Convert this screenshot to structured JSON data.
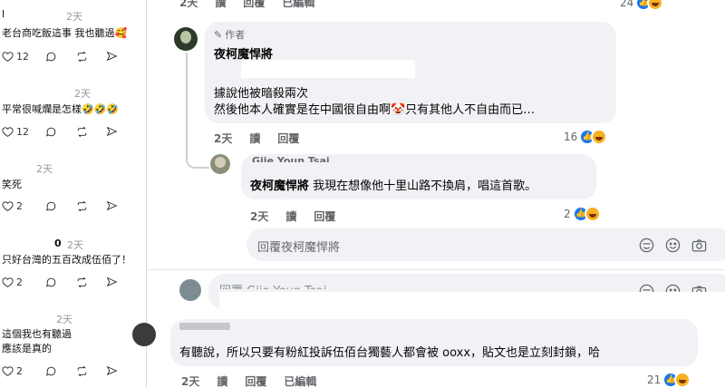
{
  "left_pane": {
    "posts": [
      {
        "time": "2天",
        "text_lines": [
          "老台商吃飯這事 我也聽過🥰"
        ],
        "likes": "12"
      },
      {
        "time": "2天",
        "text_lines": [
          "平常很喊爛是怎樣🤣🤣🤣"
        ],
        "likes": "12"
      },
      {
        "time": "2天",
        "text_lines": [
          "笑死"
        ],
        "likes": "2"
      },
      {
        "time": "2天",
        "count": "0",
        "text_lines": [
          "只好台灣的五百改成伍佰了！"
        ],
        "likes": "2"
      },
      {
        "time": "2天",
        "text_lines": [
          "這個我也有聽過",
          "應該是真的"
        ],
        "likes": "2"
      }
    ],
    "head_fragment": "l"
  },
  "comments": {
    "top_meta": {
      "time": "2天",
      "read": "讀",
      "reply": "回覆",
      "edited": "已編輯",
      "count": "24"
    },
    "author_comment": {
      "badge": "作者",
      "name": "夜柯魔悍將",
      "line1": "據說他被暗殺兩次",
      "line2": "然後他本人確實是在中國很自由啊🤡只有其他人不自由而已…",
      "meta": {
        "time": "2天",
        "read": "讀",
        "reply": "回覆",
        "count": "16"
      }
    },
    "reply_comment": {
      "partial_name": "Gjie Youn Tsai",
      "mention": "夜柯魔悍將",
      "text": "我現在想像他十里山路不換肩，唱這首歌。",
      "meta": {
        "time": "2天",
        "read": "讀",
        "reply": "回覆",
        "count": "2"
      }
    },
    "reply_box_1": {
      "placeholder": "回覆夜柯魔悍將"
    },
    "reply_box_2": {
      "placeholder": "回覆 Gjie Youn Tsai"
    },
    "last_comment": {
      "text": "有聽說，所以只要有粉紅投訴伍佰台獨藝人都會被 ooxx，貼文也是立刻封鎖，哈",
      "meta": {
        "time": "2天",
        "read": "讀",
        "reply": "回覆",
        "edited": "已編輯",
        "count": "21"
      }
    }
  },
  "colors": {
    "like": "#1877f2",
    "haha": "#f7b125",
    "bubble": "#f0f2f5",
    "meta": "#65676b"
  }
}
